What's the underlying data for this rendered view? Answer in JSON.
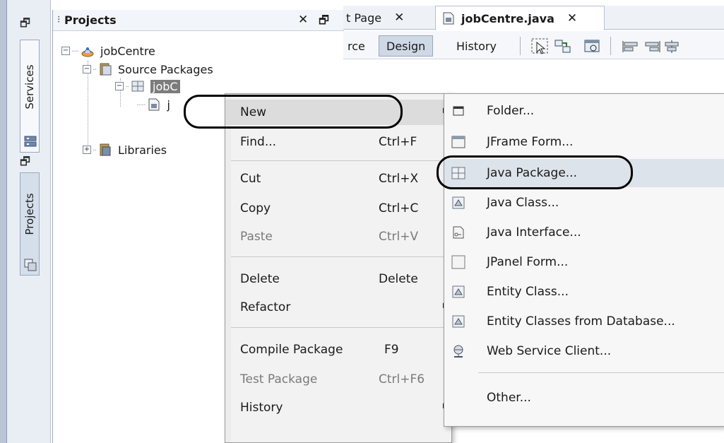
{
  "side_bar": {
    "services_label": "Services",
    "projects_label": "Projects"
  },
  "projects_panel": {
    "title": "Projects",
    "tree": {
      "project": "jobCentre",
      "source_packages": "Source Packages",
      "package": "jobC",
      "file_stub": "j",
      "libraries": "Libraries"
    }
  },
  "editor": {
    "tabs": [
      {
        "label": "t Page"
      },
      {
        "label": "jobCentre.java"
      }
    ],
    "toolbar": {
      "source": "rce",
      "design": "Design",
      "history": "History"
    }
  },
  "context_menu": {
    "items": [
      {
        "label": "New",
        "shortcut": ""
      },
      {
        "label": "Find...",
        "shortcut": "Ctrl+F"
      },
      {
        "label": "Cut",
        "shortcut": "Ctrl+X"
      },
      {
        "label": "Copy",
        "shortcut": "Ctrl+C"
      },
      {
        "label": "Paste",
        "shortcut": "Ctrl+V"
      },
      {
        "label": "Delete",
        "shortcut": "Delete"
      },
      {
        "label": "Refactor",
        "shortcut": ""
      },
      {
        "label": "Compile Package",
        "shortcut": "F9"
      },
      {
        "label": "Test Package",
        "shortcut": "Ctrl+F6"
      },
      {
        "label": "History",
        "shortcut": ""
      }
    ]
  },
  "new_submenu": {
    "items": [
      {
        "label": "Folder...",
        "icon": "folder-icon"
      },
      {
        "label": "JFrame Form...",
        "icon": "jframe-icon"
      },
      {
        "label": "Java Package...",
        "icon": "package-icon"
      },
      {
        "label": "Java Class...",
        "icon": "class-icon"
      },
      {
        "label": "Java Interface...",
        "icon": "interface-icon"
      },
      {
        "label": "JPanel Form...",
        "icon": "jpanel-icon"
      },
      {
        "label": "Entity Class...",
        "icon": "entity-icon"
      },
      {
        "label": "Entity Classes from Database...",
        "icon": "entity-db-icon"
      },
      {
        "label": "Web Service Client...",
        "icon": "web-service-icon"
      },
      {
        "label": "Other...",
        "icon": ""
      }
    ]
  }
}
